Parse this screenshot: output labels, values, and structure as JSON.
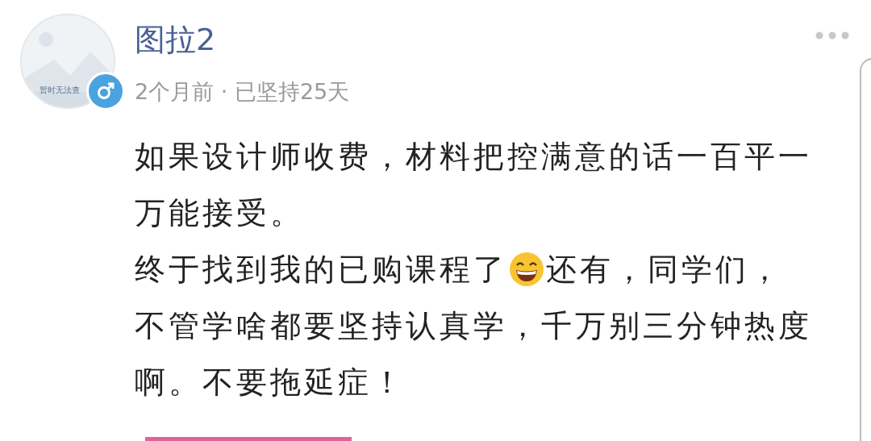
{
  "author": {
    "name": "图拉2",
    "avatar_caption": "暂时无法查",
    "meta": "2个月前 · 已坚持25天"
  },
  "comment": {
    "lines": [
      {
        "parts": [
          {
            "kind": "text",
            "text": "如果设计师收费，材料把控满意的话一百平一"
          }
        ]
      },
      {
        "parts": [
          {
            "kind": "text",
            "text": "万能接受。"
          }
        ]
      },
      {
        "parts": [
          {
            "kind": "text",
            "text": "终于找到我的已购课程了"
          },
          {
            "kind": "emoji"
          },
          {
            "kind": "text",
            "text": "还有，同学们，"
          }
        ]
      },
      {
        "parts": [
          {
            "kind": "text",
            "text": "不管学啥都要坚持认真学，千万别三分钟热度"
          }
        ]
      },
      {
        "parts": [
          {
            "kind": "text",
            "text": "啊。不要拖延症！"
          }
        ]
      }
    ]
  }
}
